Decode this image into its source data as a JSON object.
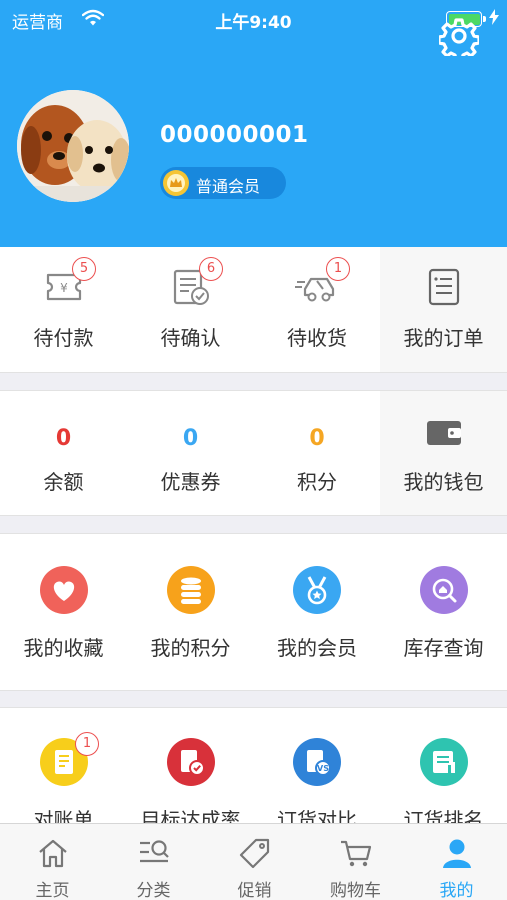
{
  "status_bar": {
    "carrier": "运营商",
    "time": "上午9:40"
  },
  "profile": {
    "user_id": "000000001",
    "member_level": "普通会员"
  },
  "orders": {
    "items": [
      {
        "label": "待付款",
        "count": "5",
        "icon": "payment-pending-icon"
      },
      {
        "label": "待确认",
        "count": "6",
        "icon": "confirm-pending-icon"
      },
      {
        "label": "待收货",
        "count": "1",
        "icon": "delivery-truck-icon"
      },
      {
        "label": "我的订单",
        "icon": "order-list-icon"
      }
    ]
  },
  "wallet": {
    "items": [
      {
        "label": "余额",
        "value": "0",
        "color": "#e53935"
      },
      {
        "label": "优惠券",
        "value": "0",
        "color": "#3aa7f2"
      },
      {
        "label": "积分",
        "value": "0",
        "color": "#f5a623"
      },
      {
        "label": "我的钱包",
        "icon": "wallet-icon"
      }
    ]
  },
  "services": {
    "items": [
      {
        "label": "我的收藏",
        "icon": "heart-icon",
        "color": "#f0625a"
      },
      {
        "label": "我的积分",
        "icon": "coins-icon",
        "color": "#f7a21b"
      },
      {
        "label": "我的会员",
        "icon": "medal-icon",
        "color": "#3aa7f2"
      },
      {
        "label": "库存查询",
        "icon": "inventory-search-icon",
        "color": "#a07be0"
      }
    ]
  },
  "reports": {
    "items": [
      {
        "label": "对账单",
        "count": "1",
        "icon": "statement-icon",
        "color": "#f7ce1b"
      },
      {
        "label": "目标达成率",
        "icon": "target-icon",
        "color": "#d8313a"
      },
      {
        "label": "订货对比",
        "icon": "compare-icon",
        "color": "#2f83d8"
      },
      {
        "label": "订货排名",
        "icon": "ranking-icon",
        "color": "#2ec4b0"
      }
    ]
  },
  "tabbar": {
    "items": [
      {
        "label": "主页",
        "icon": "home-icon"
      },
      {
        "label": "分类",
        "icon": "category-icon"
      },
      {
        "label": "促销",
        "icon": "promotion-tag-icon"
      },
      {
        "label": "购物车",
        "icon": "cart-icon"
      },
      {
        "label": "我的",
        "icon": "profile-icon",
        "active": true
      }
    ]
  }
}
